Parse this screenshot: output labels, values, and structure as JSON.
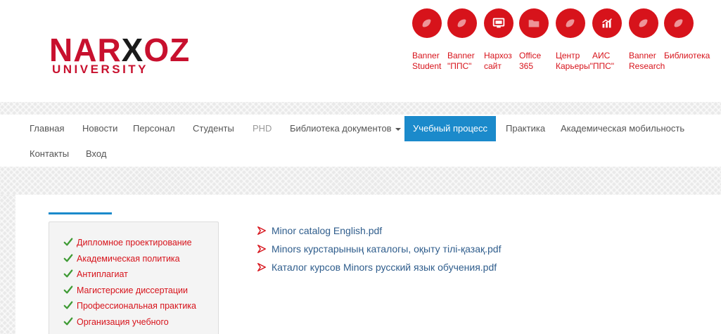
{
  "logo": {
    "word_a": "NAR",
    "word_x": "X",
    "word_b": "OZ",
    "sub": "UNIVERSITY"
  },
  "quick_links": [
    {
      "icon": "circle-icon",
      "line1": "Banner",
      "line2": "Student"
    },
    {
      "icon": "circle-icon",
      "line1": "Banner",
      "line2": "\"ППС\""
    },
    {
      "icon": "monitor-icon",
      "line1": "Нархоз",
      "line2": "сайт"
    },
    {
      "icon": "folder-icon",
      "line1": "Office",
      "line2": "365"
    },
    {
      "icon": "circle-icon",
      "line1": "Центр",
      "line2": "Карьеры\"ППС\""
    },
    {
      "icon": "chart-icon",
      "line1": "АИС",
      "line2": ""
    },
    {
      "icon": "circle-icon",
      "line1": "Banner",
      "line2": "Research"
    },
    {
      "icon": "circle-icon",
      "line1": "Библиотека",
      "line2": ""
    }
  ],
  "nav": {
    "items": [
      "Главная",
      "Новости",
      "Персонал",
      "Студенты",
      "PHD",
      "Библиотека документов",
      "Учебный процесс",
      "Практика",
      "Академическая мобильность",
      "Контакты",
      "Вход"
    ],
    "active_index": 6
  },
  "sidebar": {
    "items": [
      "Дипломное проектирование",
      "Академическая политика",
      "Антиплагиат",
      "Магистерские диссертации",
      "Профессиональная практика",
      "Организация учебного"
    ]
  },
  "files": [
    "Minor catalog English.pdf",
    "Minors курстарының каталогы, оқыту тілі-қазақ.pdf",
    "Каталог курсов Minors русский язык обучения.pdf"
  ],
  "colors": {
    "brand_red": "#d7131b",
    "nav_active": "#1b8acb",
    "link_blue": "#2f5d8c"
  }
}
